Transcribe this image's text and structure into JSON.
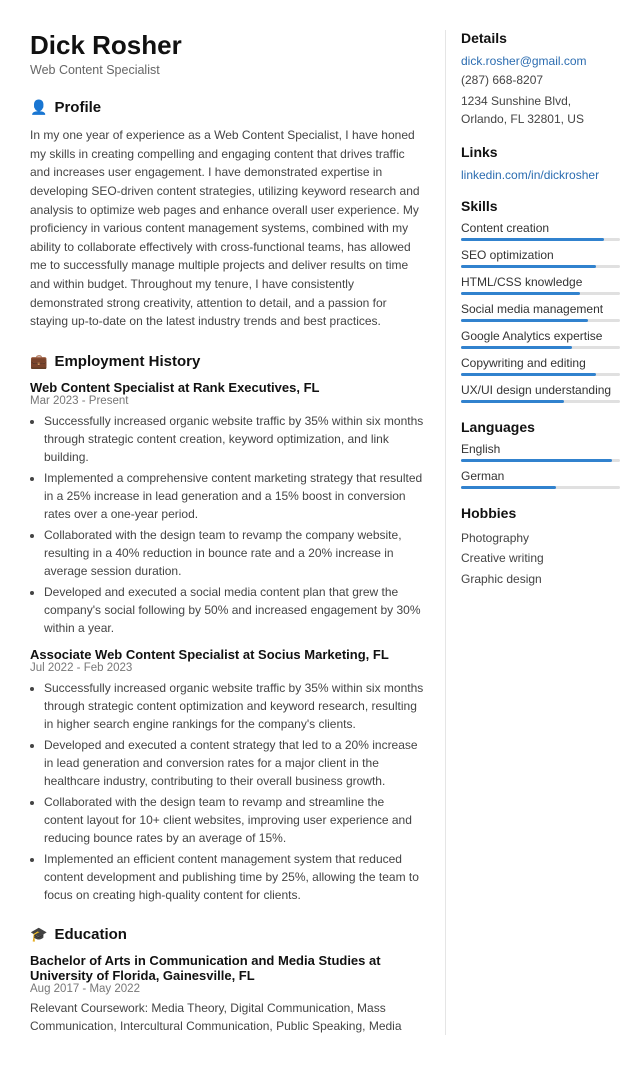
{
  "header": {
    "name": "Dick Rosher",
    "job_title": "Web Content Specialist"
  },
  "profile": {
    "section_label": "Profile",
    "icon": "👤",
    "text": "In my one year of experience as a Web Content Specialist, I have honed my skills in creating compelling and engaging content that drives traffic and increases user engagement. I have demonstrated expertise in developing SEO-driven content strategies, utilizing keyword research and analysis to optimize web pages and enhance overall user experience. My proficiency in various content management systems, combined with my ability to collaborate effectively with cross-functional teams, has allowed me to successfully manage multiple projects and deliver results on time and within budget. Throughout my tenure, I have consistently demonstrated strong creativity, attention to detail, and a passion for staying up-to-date on the latest industry trends and best practices."
  },
  "employment": {
    "section_label": "Employment History",
    "icon": "💼",
    "jobs": [
      {
        "title": "Web Content Specialist at Rank Executives, FL",
        "date": "Mar 2023 - Present",
        "bullets": [
          "Successfully increased organic website traffic by 35% within six months through strategic content creation, keyword optimization, and link building.",
          "Implemented a comprehensive content marketing strategy that resulted in a 25% increase in lead generation and a 15% boost in conversion rates over a one-year period.",
          "Collaborated with the design team to revamp the company website, resulting in a 40% reduction in bounce rate and a 20% increase in average session duration.",
          "Developed and executed a social media content plan that grew the company's social following by 50% and increased engagement by 30% within a year."
        ]
      },
      {
        "title": "Associate Web Content Specialist at Socius Marketing, FL",
        "date": "Jul 2022 - Feb 2023",
        "bullets": [
          "Successfully increased organic website traffic by 35% within six months through strategic content optimization and keyword research, resulting in higher search engine rankings for the company's clients.",
          "Developed and executed a content strategy that led to a 20% increase in lead generation and conversion rates for a major client in the healthcare industry, contributing to their overall business growth.",
          "Collaborated with the design team to revamp and streamline the content layout for 10+ client websites, improving user experience and reducing bounce rates by an average of 15%.",
          "Implemented an efficient content management system that reduced content development and publishing time by 25%, allowing the team to focus on creating high-quality content for clients."
        ]
      }
    ]
  },
  "education": {
    "section_label": "Education",
    "icon": "🎓",
    "items": [
      {
        "degree": "Bachelor of Arts in Communication and Media Studies at University of Florida, Gainesville, FL",
        "date": "Aug 2017 - May 2022",
        "text": "Relevant Coursework: Media Theory, Digital Communication, Mass Communication, Intercultural Communication, Public Speaking, Media"
      }
    ]
  },
  "details": {
    "section_label": "Details",
    "email": "dick.rosher@gmail.com",
    "phone": "(287) 668-8207",
    "address": "1234 Sunshine Blvd, Orlando, FL 32801, US"
  },
  "links": {
    "section_label": "Links",
    "items": [
      {
        "label": "linkedin.com/in/dickrosher",
        "url": "https://linkedin.com/in/dickrosher"
      }
    ]
  },
  "skills": {
    "section_label": "Skills",
    "items": [
      {
        "name": "Content creation",
        "pct": 90
      },
      {
        "name": "SEO optimization",
        "pct": 85
      },
      {
        "name": "HTML/CSS knowledge",
        "pct": 75
      },
      {
        "name": "Social media management",
        "pct": 80
      },
      {
        "name": "Google Analytics expertise",
        "pct": 70
      },
      {
        "name": "Copywriting and editing",
        "pct": 85
      },
      {
        "name": "UX/UI design understanding",
        "pct": 65
      }
    ]
  },
  "languages": {
    "section_label": "Languages",
    "items": [
      {
        "name": "English",
        "pct": 95
      },
      {
        "name": "German",
        "pct": 60
      }
    ]
  },
  "hobbies": {
    "section_label": "Hobbies",
    "items": [
      "Photography",
      "Creative writing",
      "Graphic design"
    ]
  }
}
